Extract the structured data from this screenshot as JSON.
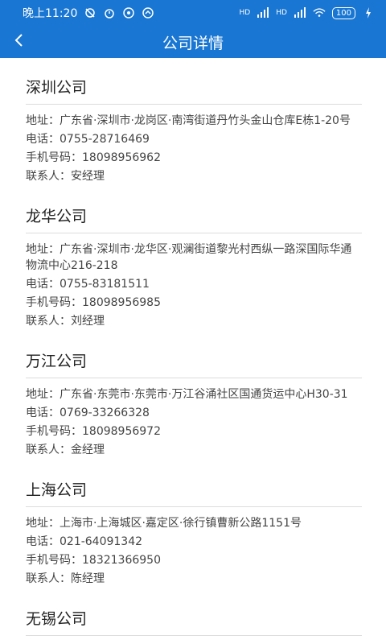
{
  "status_bar": {
    "time": "晚上11:20",
    "network1": "HD",
    "network2": "HD",
    "battery": "100",
    "icons": [
      "alarm-off-icon",
      "alarm-icon",
      "app-icon-a",
      "app-icon-b",
      "signal-icon",
      "signal-icon",
      "wifi-icon",
      "charging-icon"
    ]
  },
  "header": {
    "title": "公司详情",
    "back_icon": "chevron-left-icon"
  },
  "companies": [
    {
      "name": "深圳公司",
      "address_label": "地址：",
      "address": "广东省·深圳市·龙岗区·南湾街道丹竹头金山仓库E栋1-20号",
      "phone_label": "电话：",
      "phone": "0755-28716469",
      "mobile_label": "手机号码：",
      "mobile": "18098956962",
      "contact_label": "联系人：",
      "contact": "安经理"
    },
    {
      "name": "龙华公司",
      "address_label": "地址：",
      "address": "广东省·深圳市·龙华区·观澜街道黎光村西纵一路深国际华通物流中心216-218",
      "phone_label": "电话：",
      "phone": "0755-83181511",
      "mobile_label": "手机号码：",
      "mobile": "18098956985",
      "contact_label": "联系人：",
      "contact": "刘经理"
    },
    {
      "name": "万江公司",
      "address_label": "地址：",
      "address": "广东省·东莞市·东莞市·万江谷涌社区国通货运中心H30-31",
      "phone_label": "电话：",
      "phone": "0769-33266328",
      "mobile_label": "手机号码：",
      "mobile": "18098956972",
      "contact_label": "联系人：",
      "contact": "金经理"
    },
    {
      "name": "上海公司",
      "address_label": "地址：",
      "address": "上海市·上海城区·嘉定区·徐行镇曹新公路1151号",
      "phone_label": "电话：",
      "phone": "021-64091342",
      "mobile_label": "手机号码：",
      "mobile": "18321366950",
      "contact_label": "联系人：",
      "contact": "陈经理"
    },
    {
      "name": "无锡公司"
    }
  ]
}
